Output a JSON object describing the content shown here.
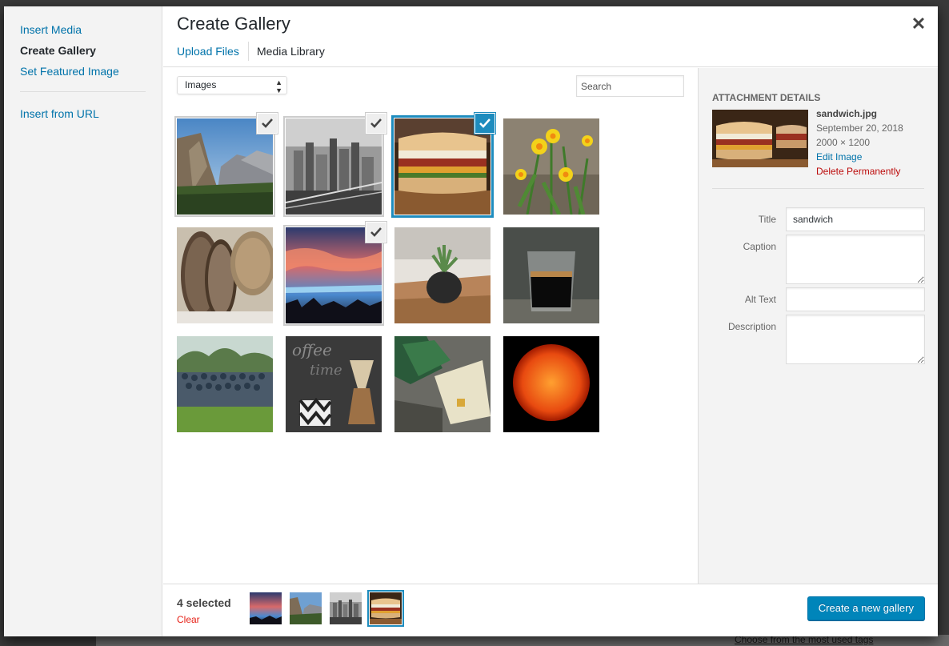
{
  "menu": {
    "items": [
      {
        "label": "Insert Media"
      },
      {
        "label": "Create Gallery"
      },
      {
        "label": "Set Featured Image"
      }
    ],
    "secondary": {
      "label": "Insert from URL"
    }
  },
  "frame": {
    "title": "Create Gallery",
    "close_icon": "close-icon"
  },
  "router": {
    "upload_label": "Upload Files",
    "library_label": "Media Library"
  },
  "toolbar_top": {
    "filter_value": "Images",
    "search_placeholder": "Search"
  },
  "attachments": [
    {
      "name": "mountain-valley",
      "selected": true
    },
    {
      "name": "city-skyline",
      "selected": true
    },
    {
      "name": "sandwich",
      "selected": true,
      "details": true
    },
    {
      "name": "daffodils",
      "selected": false
    },
    {
      "name": "bread",
      "selected": false
    },
    {
      "name": "sunset",
      "selected": true
    },
    {
      "name": "succulent",
      "selected": false
    },
    {
      "name": "espresso",
      "selected": false
    },
    {
      "name": "group-photo",
      "selected": false
    },
    {
      "name": "coffee",
      "selected": false
    },
    {
      "name": "certificate",
      "selected": false
    },
    {
      "name": "sun",
      "selected": false
    }
  ],
  "details": {
    "heading": "Attachment Details",
    "filename": "sandwich.jpg",
    "date": "September 20, 2018",
    "dimensions": "2000 × 1200",
    "edit_label": "Edit Image",
    "delete_label": "Delete Permanently",
    "fields": {
      "title_label": "Title",
      "title_value": "sandwich",
      "caption_label": "Caption",
      "alt_label": "Alt Text",
      "description_label": "Description"
    }
  },
  "toolbar": {
    "count": "4 selected",
    "clear_label": "Clear",
    "create_label": "Create a new gallery"
  },
  "background": {
    "link_text": "Choose from the most used tags"
  },
  "colors": {
    "accent": "#1e8cbe",
    "link": "#0073aa",
    "danger": "#bc0b0b",
    "button": "#0085ba"
  }
}
